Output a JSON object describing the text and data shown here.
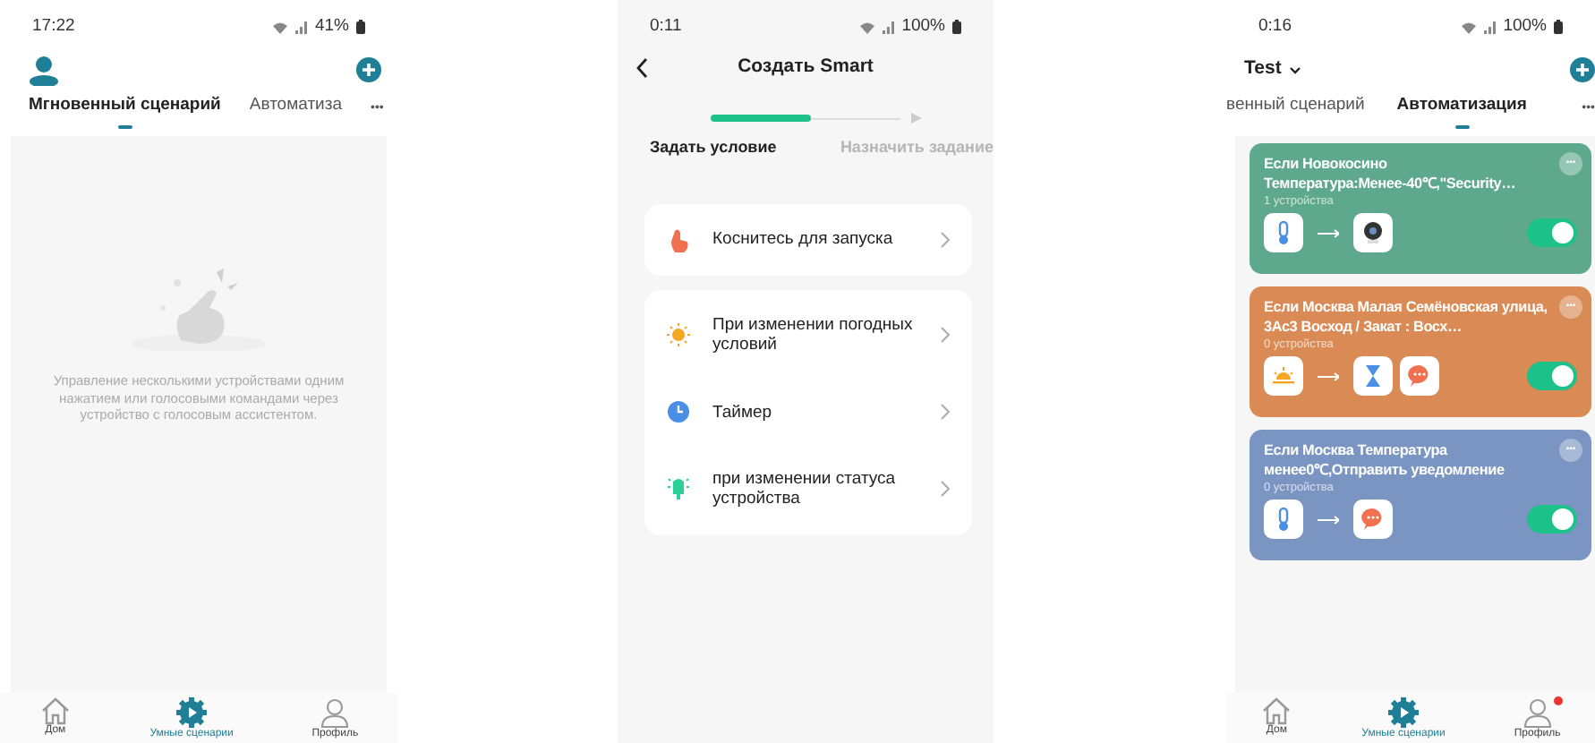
{
  "scenes_screen": {
    "status": {
      "time": "17:22",
      "battery": "41%"
    },
    "tabs": [
      {
        "label": "Мгновенный сценарий",
        "selected": true
      },
      {
        "label": "Автоматиза",
        "selected": false
      }
    ],
    "more": "•••",
    "empty_text": "Управление несколькими устройствами одним нажатием или голосовыми командами через устройство с голосовым ассистентом.",
    "nav": [
      {
        "label": "Дом",
        "kind": "home",
        "selected": false,
        "badge": false
      },
      {
        "label": "Умные сценарии",
        "kind": "scenes",
        "selected": true,
        "badge": false
      },
      {
        "label": "Профиль",
        "kind": "profile",
        "selected": false,
        "badge": false
      }
    ]
  },
  "create_screen": {
    "status": {
      "time": "0:11",
      "battery": "100%"
    },
    "title": "Создать Smart",
    "progress": {
      "level": 0.5
    },
    "steps": [
      {
        "label": "Задать условие",
        "selected": true
      },
      {
        "label": "Назначить задание",
        "selected": false
      }
    ],
    "groups": [
      [
        {
          "kind": "touch",
          "label": "Коснитесь для запуска"
        }
      ],
      [
        {
          "kind": "weather",
          "label": "При изменении погодных условий"
        },
        {
          "kind": "timer",
          "label": "Таймер"
        },
        {
          "kind": "device",
          "label": "при изменении статуса устройства"
        }
      ]
    ]
  },
  "automation_screen": {
    "status": {
      "time": "0:16",
      "battery": "100%"
    },
    "home": "Test",
    "tabs": [
      {
        "label": "венный сценарий",
        "selected": false
      },
      {
        "label": "Автоматизация",
        "selected": true
      }
    ],
    "more": "•••",
    "cards": [
      {
        "color": "#5ea88e",
        "title": "Если Новокосино Температура:Менее-40℃,\"Security…",
        "devices": "1 устройства",
        "conditions": [
          {
            "kind": "thermometer"
          }
        ],
        "actions": [
          {
            "kind": "camera"
          }
        ],
        "on": true
      },
      {
        "color": "#d98a55",
        "title": "Если Москва Малая Семёновская улица, 3Ас3 Восход / Закат : Восх…",
        "devices": "0 устройства",
        "conditions": [
          {
            "kind": "sunrise"
          }
        ],
        "actions": [
          {
            "kind": "hourglass"
          },
          {
            "kind": "message"
          }
        ],
        "on": true
      },
      {
        "color": "#7b95c2",
        "title": "Если Москва Температура менее0℃,Отправить уведомление",
        "devices": "0 устройства",
        "conditions": [
          {
            "kind": "thermometer"
          }
        ],
        "actions": [
          {
            "kind": "message"
          }
        ],
        "on": true
      }
    ],
    "nav": [
      {
        "label": "Дом",
        "kind": "home",
        "selected": false,
        "badge": false
      },
      {
        "label": "Умные сценарии",
        "kind": "scenes",
        "selected": true,
        "badge": false
      },
      {
        "label": "Профиль",
        "kind": "profile",
        "selected": false,
        "badge": true
      }
    ]
  }
}
